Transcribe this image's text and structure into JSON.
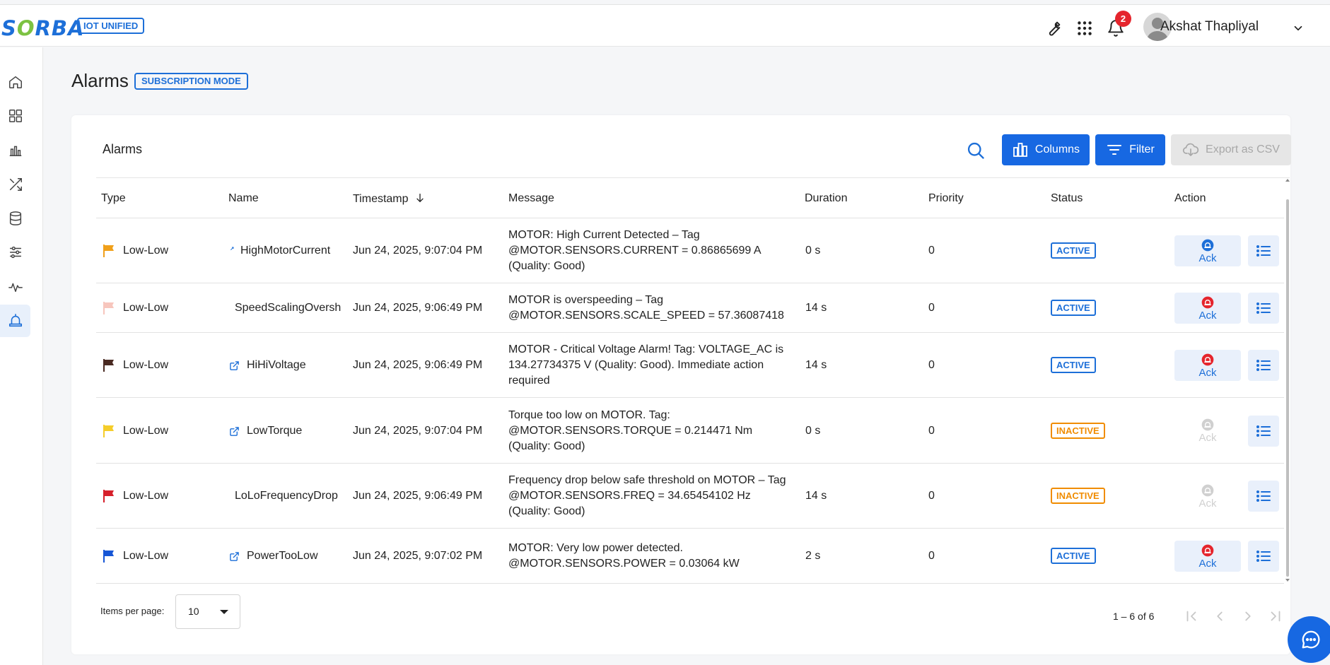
{
  "brand": {
    "logo_text": "SORBA",
    "badge": "IOT UNIFIED"
  },
  "topbar": {
    "notification_count": "2",
    "user_name": "Akshat Thapliyal"
  },
  "page": {
    "title": "Alarms",
    "mode_badge": "SUBSCRIPTION MODE"
  },
  "card": {
    "title": "Alarms",
    "columns_label": "Columns",
    "filter_label": "Filter",
    "export_label": "Export as CSV"
  },
  "table": {
    "headers": {
      "type": "Type",
      "name": "Name",
      "timestamp": "Timestamp",
      "message": "Message",
      "duration": "Duration",
      "priority": "Priority",
      "status": "Status",
      "action": "Action"
    },
    "rows": [
      {
        "type": "Low-Low",
        "flag_color": "#f0a01a",
        "name": "HighMotorCurrent",
        "link_icon": "small",
        "timestamp": "Jun 24, 2025, 9:07:04 PM",
        "message": "MOTOR: High Current Detected – Tag @MOTOR.SENSORS.CURRENT = 0.86865699 A (Quality: Good)",
        "duration": "0 s",
        "priority": "0",
        "status": "ACTIVE",
        "ack": "Ack",
        "ack_enabled": true,
        "ack_icon_color": "#1d6fd8"
      },
      {
        "type": "Low-Low",
        "flag_color": "#f7c6bd",
        "name": "SpeedScalingOversh",
        "link_icon": "none",
        "timestamp": "Jun 24, 2025, 9:06:49 PM",
        "message": "MOTOR is overspeeding – Tag @MOTOR.SENSORS.SCALE_SPEED = 57.36087418",
        "duration": "14 s",
        "priority": "0",
        "status": "ACTIVE",
        "ack": "Ack",
        "ack_enabled": true,
        "ack_icon_color": "#e5252d"
      },
      {
        "type": "Low-Low",
        "flag_color": "#4a2a22",
        "name": "HiHiVoltage",
        "link_icon": "external",
        "timestamp": "Jun 24, 2025, 9:06:49 PM",
        "message": "MOTOR - Critical Voltage Alarm! Tag: VOLTAGE_AC is 134.27734375 V (Quality: Good). Immediate action required",
        "duration": "14 s",
        "priority": "0",
        "status": "ACTIVE",
        "ack": "Ack",
        "ack_enabled": true,
        "ack_icon_color": "#e5252d"
      },
      {
        "type": "Low-Low",
        "flag_color": "#f5cd2a",
        "name": "LowTorque",
        "link_icon": "external",
        "timestamp": "Jun 24, 2025, 9:07:04 PM",
        "message": "Torque too low on MOTOR. Tag: @MOTOR.SENSORS.TORQUE = 0.214471 Nm (Quality: Good)",
        "duration": "0 s",
        "priority": "0",
        "status": "INACTIVE",
        "ack": "Ack",
        "ack_enabled": false,
        "ack_icon_color": "#d0d0d0"
      },
      {
        "type": "Low-Low",
        "flag_color": "#d6202b",
        "name": "LoLoFrequencyDrop",
        "link_icon": "none",
        "timestamp": "Jun 24, 2025, 9:06:49 PM",
        "message": "Frequency drop below safe threshold on MOTOR – Tag @MOTOR.SENSORS.FREQ = 34.65454102 Hz (Quality: Good)",
        "duration": "14 s",
        "priority": "0",
        "status": "INACTIVE",
        "ack": "Ack",
        "ack_enabled": false,
        "ack_icon_color": "#d0d0d0"
      },
      {
        "type": "Low-Low",
        "flag_color": "#1656d6",
        "name": "PowerTooLow",
        "link_icon": "external",
        "timestamp": "Jun 24, 2025, 9:07:02 PM",
        "message": "MOTOR: Very low power detected. @MOTOR.SENSORS.POWER = 0.03064 kW",
        "duration": "2 s",
        "priority": "0",
        "status": "ACTIVE",
        "ack": "Ack",
        "ack_enabled": true,
        "ack_icon_color": "#e5252d"
      }
    ]
  },
  "pagination": {
    "items_per_page_label": "Items per page:",
    "items_per_page_value": "10",
    "range": "1 – 6 of 6"
  },
  "sidebar": {
    "items": [
      "home-icon",
      "dashboard-grid-icon",
      "bar-chart-icon",
      "shuffle-icon",
      "database-icon",
      "sliders-icon",
      "pulse-icon",
      "alarm-bell-icon"
    ],
    "active": "alarm-bell-icon"
  },
  "colors": {
    "accent": "#1768e2",
    "active_status": "#1d6fd8",
    "inactive_status": "#f08c00",
    "notification": "#e5252d"
  }
}
